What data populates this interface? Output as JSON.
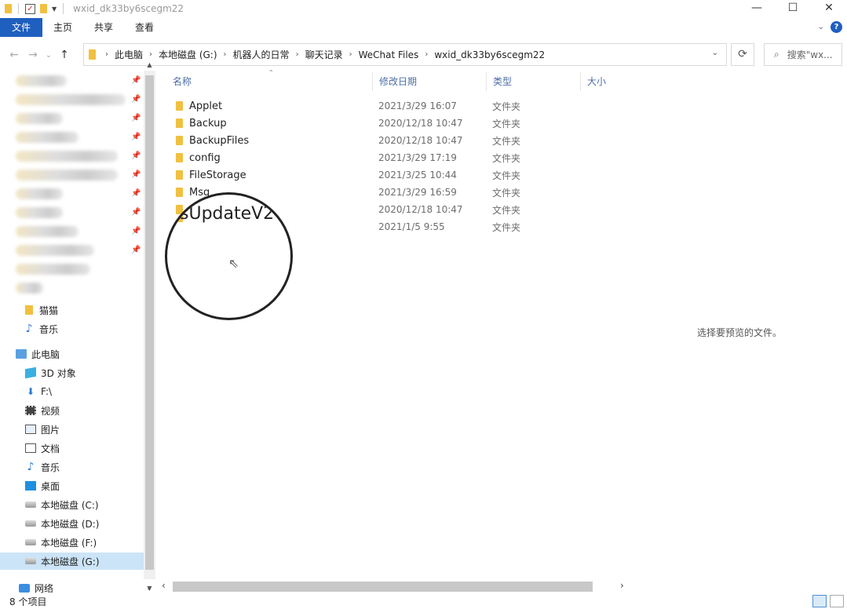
{
  "window": {
    "title": "wxid_dk33by6scegm22",
    "minimize": "—",
    "maximize": "☐",
    "close": "✕"
  },
  "ribbon": {
    "tabs": [
      "文件",
      "主页",
      "共享",
      "查看"
    ]
  },
  "nav": {
    "back": "←",
    "forward": "→",
    "recent": "⌄",
    "up": "↑",
    "breadcrumb": [
      "此电脑",
      "本地磁盘 (G:)",
      "机器人的日常",
      "聊天记录",
      "WeChat Files",
      "wxid_dk33by6scegm22"
    ],
    "refresh": "⟳",
    "search_placeholder": "搜索\"wx..."
  },
  "sidebar": {
    "pinned_count": 12,
    "items": [
      {
        "label": "猫猫",
        "icon": "folder-icon"
      },
      {
        "label": "音乐",
        "icon": "music-icon"
      },
      {
        "label": "此电脑",
        "icon": "pc-icon"
      },
      {
        "label": "3D 对象",
        "icon": "cube-icon"
      },
      {
        "label": "F:\\",
        "icon": "download-icon"
      },
      {
        "label": "视频",
        "icon": "film-icon"
      },
      {
        "label": "图片",
        "icon": "picture-icon"
      },
      {
        "label": "文档",
        "icon": "document-icon"
      },
      {
        "label": "音乐",
        "icon": "music-icon"
      },
      {
        "label": "桌面",
        "icon": "desktop-icon"
      },
      {
        "label": "本地磁盘 (C:)",
        "icon": "drive-icon"
      },
      {
        "label": "本地磁盘 (D:)",
        "icon": "drive-icon"
      },
      {
        "label": "本地磁盘 (F:)",
        "icon": "drive-icon"
      },
      {
        "label": "本地磁盘 (G:)",
        "icon": "drive-icon",
        "selected": true
      }
    ],
    "network": "网络"
  },
  "columns": {
    "name": "名称",
    "date": "修改日期",
    "type": "类型",
    "size": "大小"
  },
  "files": [
    {
      "name": "Applet",
      "date": "2021/3/29 16:07",
      "type": "文件夹"
    },
    {
      "name": "Backup",
      "date": "2020/12/18 10:47",
      "type": "文件夹"
    },
    {
      "name": "BackupFiles",
      "date": "2020/12/18 10:47",
      "type": "文件夹"
    },
    {
      "name": "config",
      "date": "2021/3/29 17:19",
      "type": "文件夹"
    },
    {
      "name": "FileStorage",
      "date": "2021/3/25 10:44",
      "type": "文件夹"
    },
    {
      "name": "Msg",
      "date": "2021/3/29 16:59",
      "type": "文件夹"
    },
    {
      "name": "",
      "date": "2020/12/18 10:47",
      "type": "文件夹"
    },
    {
      "name": "",
      "date": "2021/1/5 9:55",
      "type": "文件夹"
    }
  ],
  "magnifier": {
    "text": "sUpdateV2"
  },
  "preview": {
    "message": "选择要预览的文件。"
  },
  "status": {
    "count": "8 个项目"
  },
  "colors": {
    "file_tab": "#1f5fbf",
    "folder": "#f0c040",
    "selected_row": "#cce4f7",
    "column_header_text": "#4d6fa5"
  }
}
